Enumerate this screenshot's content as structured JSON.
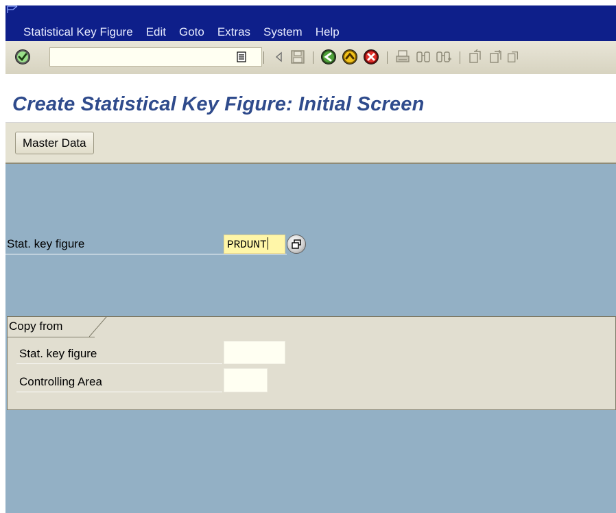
{
  "menu": [
    "Statistical Key Figure",
    "Edit",
    "Goto",
    "Extras",
    "System",
    "Help"
  ],
  "toolbar": {
    "command_value": "",
    "icons": [
      "enter-icon",
      "command-history-icon",
      "back-arrow-icon",
      "save-icon",
      "back-icon",
      "exit-icon",
      "cancel-icon",
      "print-icon",
      "find-icon",
      "find-next-icon",
      "first-page-icon",
      "previous-page-icon",
      "next-page-icon"
    ]
  },
  "title": "Create Statistical Key Figure: Initial Screen",
  "app_toolbar": {
    "master_data_label": "Master Data"
  },
  "main": {
    "stat_key_figure_label": "Stat. key figure",
    "stat_key_figure_value": "PRDUNT"
  },
  "copy_from": {
    "title": "Copy from",
    "stat_key_figure_label": "Stat. key figure",
    "stat_key_figure_value": "",
    "controlling_area_label": "Controlling Area",
    "controlling_area_value": ""
  },
  "colors": {
    "menu_bg": "#0e1f8a",
    "workarea_bg": "#93b0c5",
    "title_text": "#2f4b8c",
    "required_field": "#fff6a8"
  }
}
